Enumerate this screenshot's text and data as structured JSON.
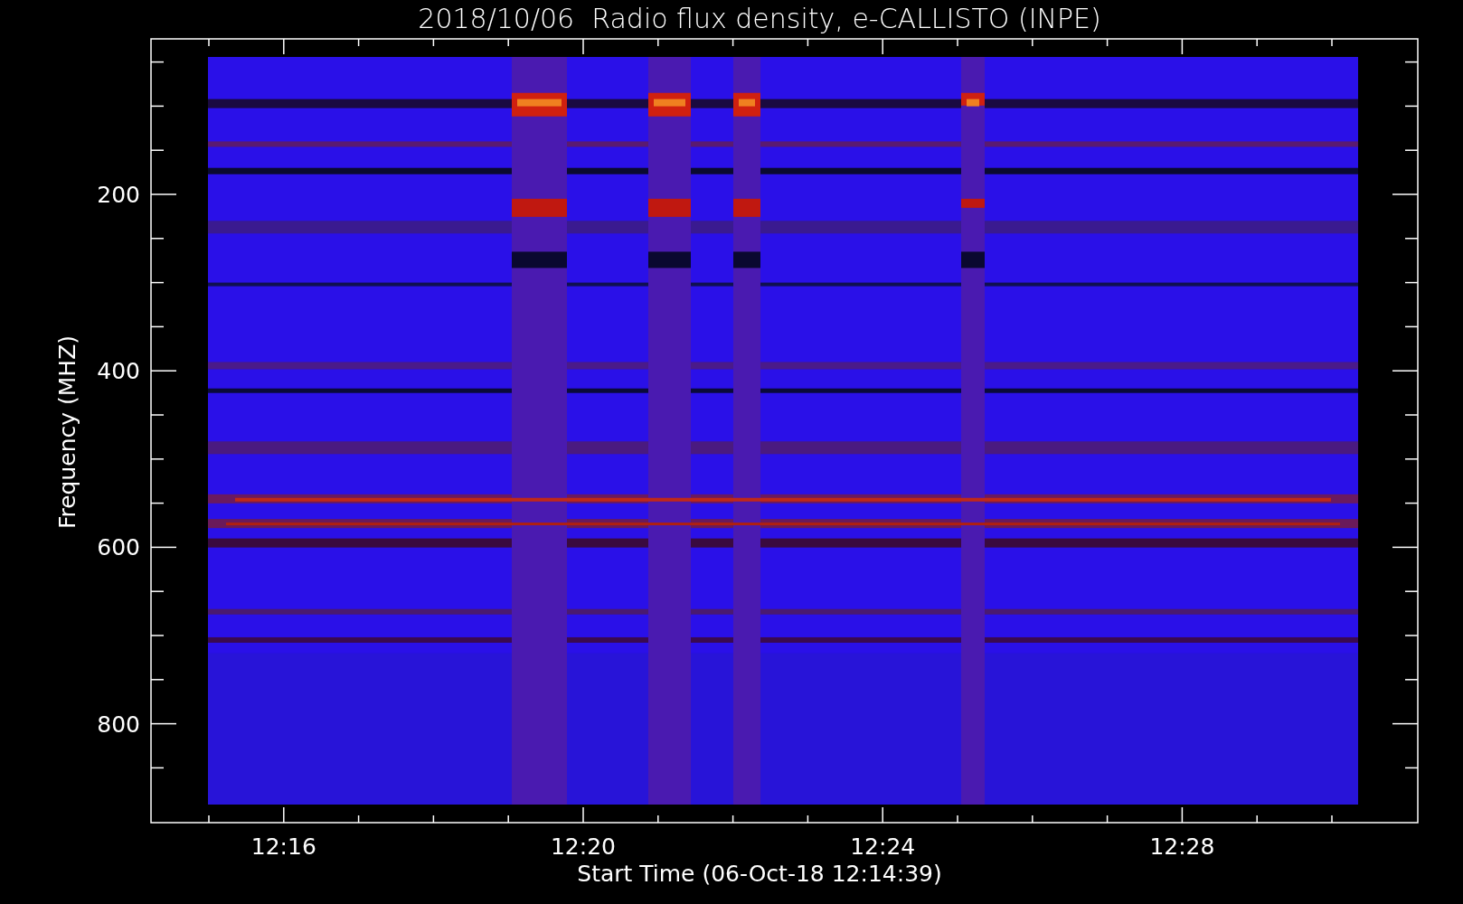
{
  "plot": {
    "title": "2018/10/06  Radio flux density, e-CALLISTO (INPE)",
    "ylabel": "Frequency (MHZ)",
    "xlabel": "Start Time (06-Oct-18 12:14:39)",
    "yticks": [
      "200",
      "400",
      "600",
      "800"
    ],
    "xticks": [
      "12:16",
      "12:20",
      "12:24",
      "12:28"
    ]
  }
}
